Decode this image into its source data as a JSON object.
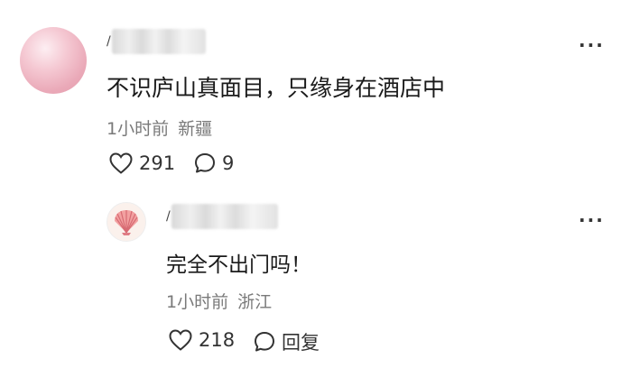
{
  "main_comment": {
    "name_prefix": "/",
    "text": "不识庐山真面目，只缘身在酒店中",
    "time": "1小时前",
    "location": "新疆",
    "likes": "291",
    "replies": "9"
  },
  "reply": {
    "name_prefix": "/",
    "text": "完全不出门吗！",
    "time": "1小时前",
    "location": "浙江",
    "likes": "218",
    "reply_label": "回复"
  },
  "icons": {
    "more": "more-dots-icon",
    "like": "heart-outline-icon",
    "comment": "comment-bubble-icon",
    "shell_avatar": "scallop-shell-icon"
  },
  "colors": {
    "text_primary": "#1a1a1a",
    "text_meta": "#7a7a7a",
    "avatar_pink": "#eaa9b8",
    "shell_pink": "#e9868a"
  }
}
